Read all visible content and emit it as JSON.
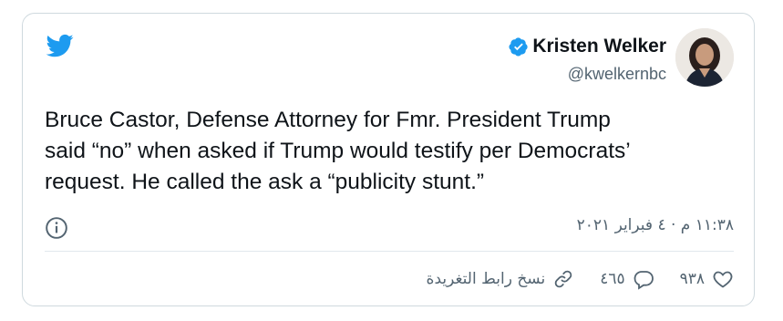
{
  "author": {
    "name": "Kristen Welker",
    "handle": "@kwelkernbc"
  },
  "tweet": {
    "text": "Bruce Castor, Defense Attorney for Fmr. President Trump\nsaid “no” when asked if Trump would testify per Democrats’\nrequest. He called the ask a “publicity stunt.”",
    "timestamp": "١١:٣٨ م · ٤ فبراير ٢٠٢١"
  },
  "actions": {
    "likes": "٩٣٨",
    "replies": "٤٦٥",
    "copy_link": "نسخ رابط التغريدة"
  },
  "colors": {
    "brand": "#1d9bf0",
    "text": "#0f1419",
    "secondary": "#536471",
    "border": "#cfd9de"
  },
  "icons": [
    "twitter-bird-icon",
    "verified-badge-icon",
    "info-icon",
    "heart-icon",
    "reply-icon",
    "link-icon"
  ]
}
